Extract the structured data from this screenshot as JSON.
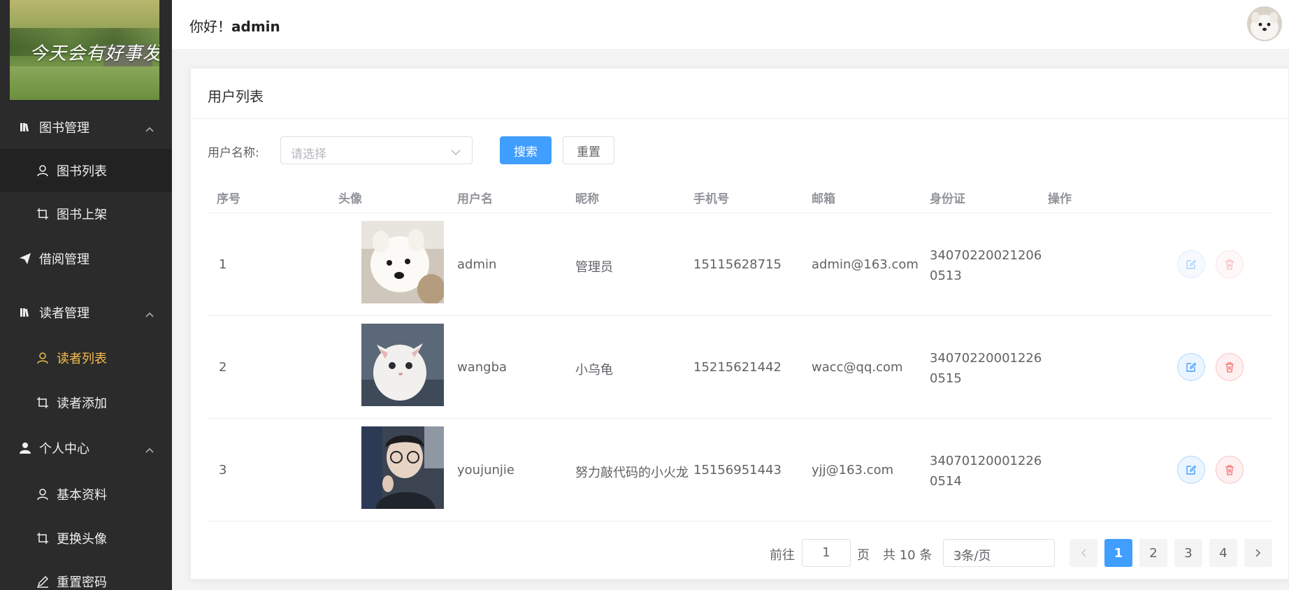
{
  "logo": {
    "text": "今天会有好事发生"
  },
  "sidebar": {
    "items": [
      {
        "label": "图书管理",
        "icon": "book-icon"
      },
      {
        "label": "图书列表",
        "icon": "user-icon"
      },
      {
        "label": "图书上架",
        "icon": "crop-icon"
      },
      {
        "label": "借阅管理",
        "icon": "send-icon"
      },
      {
        "label": "读者管理",
        "icon": "book-icon"
      },
      {
        "label": "读者列表",
        "icon": "user-icon"
      },
      {
        "label": "读者添加",
        "icon": "crop-icon"
      },
      {
        "label": "个人中心",
        "icon": "user-solid-icon"
      },
      {
        "label": "基本资料",
        "icon": "user-icon"
      },
      {
        "label": "更换头像",
        "icon": "crop-icon"
      },
      {
        "label": "重置密码",
        "icon": "edit-pen-icon"
      }
    ]
  },
  "header": {
    "greeting_prefix": "你好！",
    "username": "admin"
  },
  "card": {
    "title": "用户列表"
  },
  "filter": {
    "label": "用户名称:",
    "placeholder": "请选择",
    "search_label": "搜索",
    "reset_label": "重置"
  },
  "table": {
    "columns": [
      "序号",
      "头像",
      "用户名",
      "昵称",
      "手机号",
      "邮箱",
      "身份证",
      "操作"
    ],
    "rows": [
      {
        "index": "1",
        "username": "admin",
        "nickname": "管理员",
        "phone": "15115628715",
        "email": "admin@163.com",
        "id_card": "340702200212060513",
        "avatar": "white-dog-photo",
        "actions_disabled": true
      },
      {
        "index": "2",
        "username": "wangba",
        "nickname": "小乌龟",
        "phone": "15215621442",
        "email": "wacc@qq.com",
        "id_card": "340702200012260515",
        "avatar": "white-kitten-photo",
        "actions_disabled": false
      },
      {
        "index": "3",
        "username": "youjunjie",
        "nickname": "努力敲代码的小火龙",
        "phone": "15156951443",
        "email": "yjj@163.com",
        "id_card": "340701200012260514",
        "avatar": "person-photo",
        "actions_disabled": false
      }
    ]
  },
  "pagination": {
    "goto_prefix": "前往",
    "goto_value": "1",
    "goto_suffix": "页",
    "total_text": "共 10 条",
    "page_size": "3条/页",
    "pages": [
      "1",
      "2",
      "3",
      "4"
    ],
    "current_page": "1"
  },
  "colors": {
    "primary": "#409eff",
    "sidebar_bg": "#2b2b2b",
    "active_menu": "#f5be4c",
    "danger": "#f56c6c"
  }
}
